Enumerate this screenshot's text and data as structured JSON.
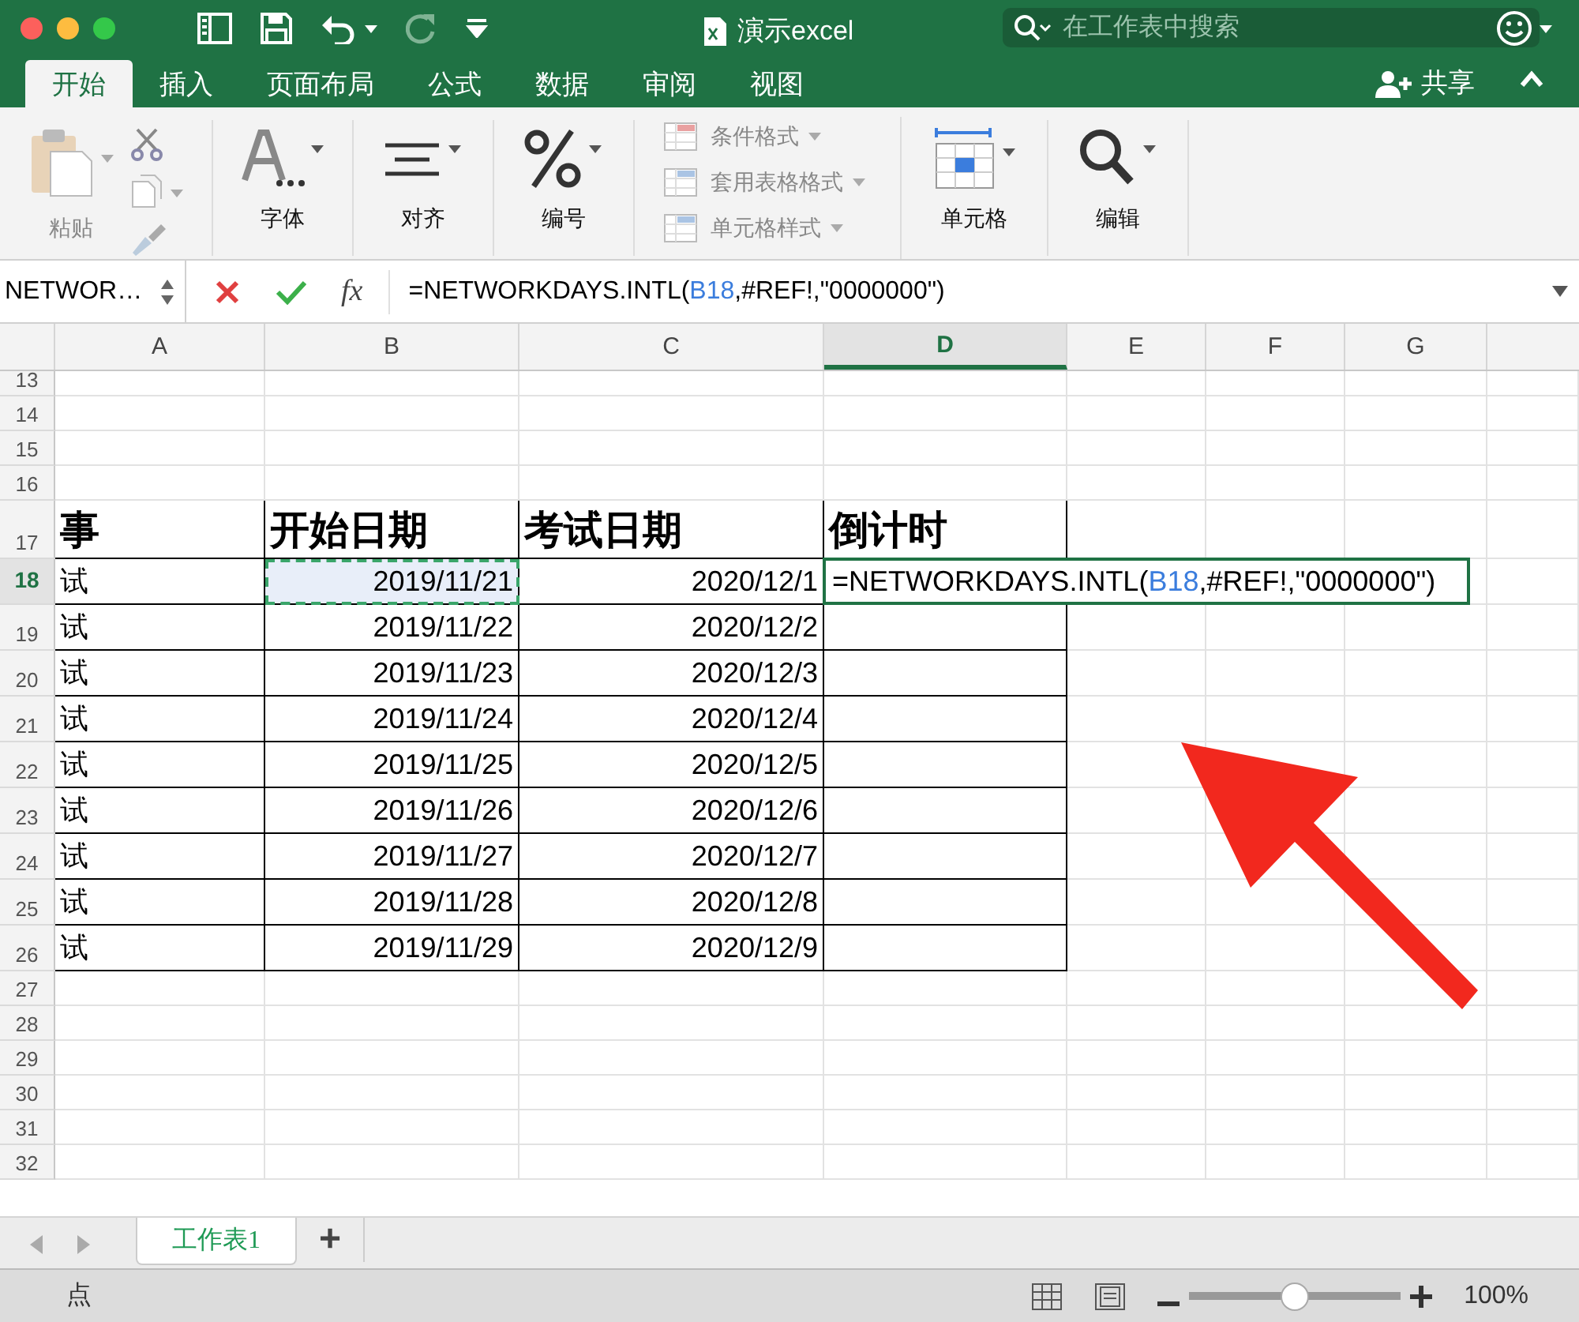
{
  "window": {
    "title": "演示excel",
    "search": {
      "placeholder": "在工作表中搜索"
    }
  },
  "ribbon_tabs": [
    {
      "label": "开始",
      "selected": true
    },
    {
      "label": "插入",
      "selected": false
    },
    {
      "label": "页面布局",
      "selected": false
    },
    {
      "label": "公式",
      "selected": false
    },
    {
      "label": "数据",
      "selected": false
    },
    {
      "label": "审阅",
      "selected": false
    },
    {
      "label": "视图",
      "selected": false
    }
  ],
  "share": {
    "label": "共享"
  },
  "ribbon_groups": [
    {
      "kind": "paste",
      "label": "粘贴",
      "disabled": true
    },
    {
      "kind": "large",
      "label": "字体",
      "disabled": false
    },
    {
      "kind": "large",
      "label": "对齐",
      "disabled": false
    },
    {
      "kind": "large",
      "label": "编号",
      "disabled": false
    },
    {
      "kind": "list",
      "items": [
        {
          "label": "条件格式",
          "disabled": true
        },
        {
          "label": "套用表格格式",
          "disabled": true
        },
        {
          "label": "单元格样式",
          "disabled": true
        }
      ]
    },
    {
      "kind": "large",
      "label": "单元格",
      "disabled": false
    },
    {
      "kind": "large",
      "label": "编辑",
      "disabled": false
    }
  ],
  "formula_bar": {
    "name_box": "NETWOR…",
    "fx": "fx",
    "parts": [
      {
        "text": "=NETWORKDAYS.INTL(",
        "kind": "plain"
      },
      {
        "text": "B18",
        "kind": "ref"
      },
      {
        "text": ",#REF!,\"0000000\")",
        "kind": "plain"
      }
    ]
  },
  "columns": [
    {
      "label": "A",
      "selected": false
    },
    {
      "label": "B",
      "selected": false
    },
    {
      "label": "C",
      "selected": false
    },
    {
      "label": "D",
      "selected": true
    },
    {
      "label": "E",
      "selected": false
    },
    {
      "label": "F",
      "selected": false
    },
    {
      "label": "G",
      "selected": false
    }
  ],
  "rows": [
    {
      "label": "13",
      "kind": "empty",
      "selected": false,
      "cells": []
    },
    {
      "label": "14",
      "kind": "empty",
      "selected": false,
      "cells": []
    },
    {
      "label": "15",
      "kind": "empty",
      "selected": false,
      "cells": []
    },
    {
      "label": "16",
      "kind": "empty",
      "selected": false,
      "cells": []
    },
    {
      "label": "17",
      "kind": "header",
      "selected": false,
      "cells": [
        {
          "text": "事"
        },
        {
          "text": "开始日期"
        },
        {
          "text": "考试日期"
        },
        {
          "text": "倒计时"
        }
      ]
    },
    {
      "label": "18",
      "kind": "data",
      "selected": true,
      "cells": [
        {
          "text": "试"
        },
        {
          "text": "2019/11/21",
          "referenced": true
        },
        {
          "text": "2020/12/1"
        },
        {
          "editing": true,
          "parts": [
            {
              "text": "=NETWORKDAYS.INTL(",
              "kind": "plain"
            },
            {
              "text": "B18",
              "kind": "ref"
            },
            {
              "text": ",#REF!,\"0000000\")",
              "kind": "plain"
            }
          ]
        }
      ]
    },
    {
      "label": "19",
      "kind": "data",
      "selected": false,
      "cells": [
        {
          "text": "试"
        },
        {
          "text": "2019/11/22"
        },
        {
          "text": "2020/12/2"
        },
        {}
      ]
    },
    {
      "label": "20",
      "kind": "data",
      "selected": false,
      "cells": [
        {
          "text": "试"
        },
        {
          "text": "2019/11/23"
        },
        {
          "text": "2020/12/3"
        },
        {}
      ]
    },
    {
      "label": "21",
      "kind": "data",
      "selected": false,
      "cells": [
        {
          "text": "试"
        },
        {
          "text": "2019/11/24"
        },
        {
          "text": "2020/12/4"
        },
        {}
      ]
    },
    {
      "label": "22",
      "kind": "data",
      "selected": false,
      "cells": [
        {
          "text": "试"
        },
        {
          "text": "2019/11/25"
        },
        {
          "text": "2020/12/5"
        },
        {}
      ]
    },
    {
      "label": "23",
      "kind": "data",
      "selected": false,
      "cells": [
        {
          "text": "试"
        },
        {
          "text": "2019/11/26"
        },
        {
          "text": "2020/12/6"
        },
        {}
      ]
    },
    {
      "label": "24",
      "kind": "data",
      "selected": false,
      "cells": [
        {
          "text": "试"
        },
        {
          "text": "2019/11/27"
        },
        {
          "text": "2020/12/7"
        },
        {}
      ]
    },
    {
      "label": "25",
      "kind": "data",
      "selected": false,
      "cells": [
        {
          "text": "试"
        },
        {
          "text": "2019/11/28"
        },
        {
          "text": "2020/12/8"
        },
        {}
      ]
    },
    {
      "label": "26",
      "kind": "data",
      "selected": false,
      "cells": [
        {
          "text": "试"
        },
        {
          "text": "2019/11/29"
        },
        {
          "text": "2020/12/9"
        },
        {}
      ]
    },
    {
      "label": "27",
      "kind": "empty",
      "selected": false,
      "cells": []
    },
    {
      "label": "28",
      "kind": "empty",
      "selected": false,
      "cells": []
    },
    {
      "label": "29",
      "kind": "empty",
      "selected": false,
      "cells": []
    },
    {
      "label": "30",
      "kind": "empty",
      "selected": false,
      "cells": []
    },
    {
      "label": "31",
      "kind": "empty",
      "selected": false,
      "cells": []
    },
    {
      "label": "32",
      "kind": "empty",
      "selected": false,
      "cells": []
    }
  ],
  "sheet_tabs": [
    {
      "label": "工作表1",
      "selected": true
    }
  ],
  "add_sheet": "+",
  "status_bar": {
    "mode": "点",
    "zoom": {
      "level": 0.5,
      "reading": "100%"
    }
  }
}
